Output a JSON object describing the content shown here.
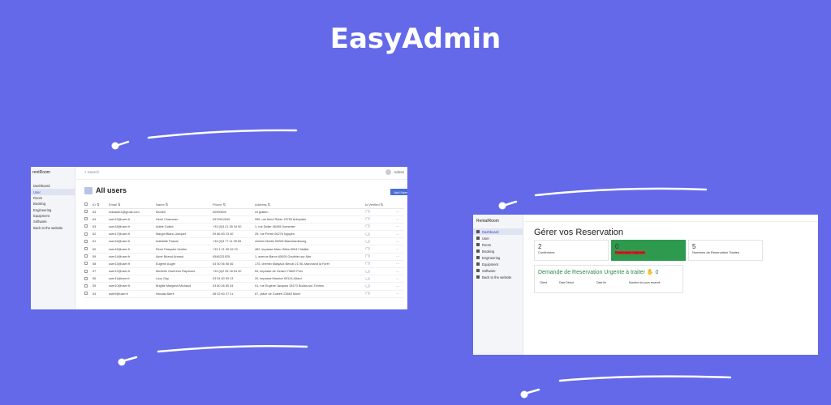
{
  "title": "EasyAdmin",
  "left_screen": {
    "brand": "rentRoom",
    "nav": [
      "Dashboard",
      "User",
      "Room",
      "Booking",
      "Engineering",
      "Equipment",
      "Software",
      "Back to the website"
    ],
    "search_placeholder": "Search",
    "admin_label": "Admin",
    "page_title": "All users",
    "add_button": "Add User",
    "columns": [
      "ID",
      "Email",
      "Name",
      "Phone",
      "Address",
      "Is Verified"
    ],
    "rows": [
      [
        "63",
        "mdsalah1@gmail.com",
        "AKAMI",
        "00990500",
        "cit gratien"
      ],
      [
        "64",
        "user19@user.fr",
        "Henri Chauveau",
        "0979914349",
        "995, rue Aimé Rubin 43753 Aubrydan"
      ],
      [
        "63",
        "user18@user.fr",
        "Adèle Guillot",
        "+33 (0)3 21 55 34 90",
        "1, rue Didier 06265 Dumenier"
      ],
      [
        "62",
        "user17@user.fr",
        "Margot Blanc-Jacquet",
        "09 86 83 23 40",
        "25, rue Perret 06276 Nguyen"
      ],
      [
        "61",
        "user16@user.fr",
        "Adélaïde Pascal",
        "+33 (0)3 77 11 08 69",
        "chemin Martin 93265 Blanchardbourg"
      ],
      [
        "60",
        "user15@user.fr",
        "René Pasquier-Verdier",
        "+33 1 21 95 26 23",
        "482, impasse Marc-Gilles 80947 Maillot"
      ],
      [
        "59",
        "user14@user.fr",
        "Aimé Briand-Arnaud",
        "0546221925",
        "1, avenue Baron 65005 Gauthier-sur-Mer"
      ],
      [
        "58",
        "user13@user.fr",
        "Eugène Auger",
        "03 50 06 98 46",
        "175, chemin Margaux Benoit 21781 Marchand la Forêt"
      ],
      [
        "57",
        "user12@user.fr",
        "Michelle Guerreiro Raymond",
        "+33 (0)2 05 18 54 30",
        "53, impasse de Gerard 73820 Prez"
      ],
      [
        "56",
        "user11@user.fr",
        "Lucy Gay",
        "03 54 60 59 13",
        "20, impasse Maurice 69124-Allard"
      ],
      [
        "55",
        "user10@user.fr",
        "Brigitte Margand Michaud",
        "03 80 46 85 34",
        "91, rue Eugène Jacques 28170 Bodan-sur-Tonnes"
      ],
      [
        "54",
        "user9@user.fr",
        "Nicolas Barre",
        "08 02 60 27 21",
        "67, place de Guibert 23663 Morel"
      ]
    ]
  },
  "right_screen": {
    "brand": "RentalRoom",
    "nav": [
      "Dashboard",
      "User",
      "Room",
      "Booking",
      "Engineering",
      "Equipment",
      "Software",
      "Back to the website"
    ],
    "page_title": "Gérer vos Reservation",
    "cards": [
      {
        "value": "2",
        "label": "Confirmées"
      },
      {
        "value": "0",
        "label": "Reservation Urgentes"
      },
      {
        "value": "5",
        "label": "Nombres de Reservation Totales"
      }
    ],
    "urgent_title": "Demande de Reservation Urgente à traiter",
    "urgent_emoji": "✋",
    "urgent_count": "0",
    "urgent_columns": [
      "Client",
      "Date Début",
      "Date fin",
      "Nombre de jours reservé"
    ]
  },
  "colors": {
    "background": "#6369e8",
    "accent": "#4a6fd8",
    "green": "#2e9a4e"
  }
}
